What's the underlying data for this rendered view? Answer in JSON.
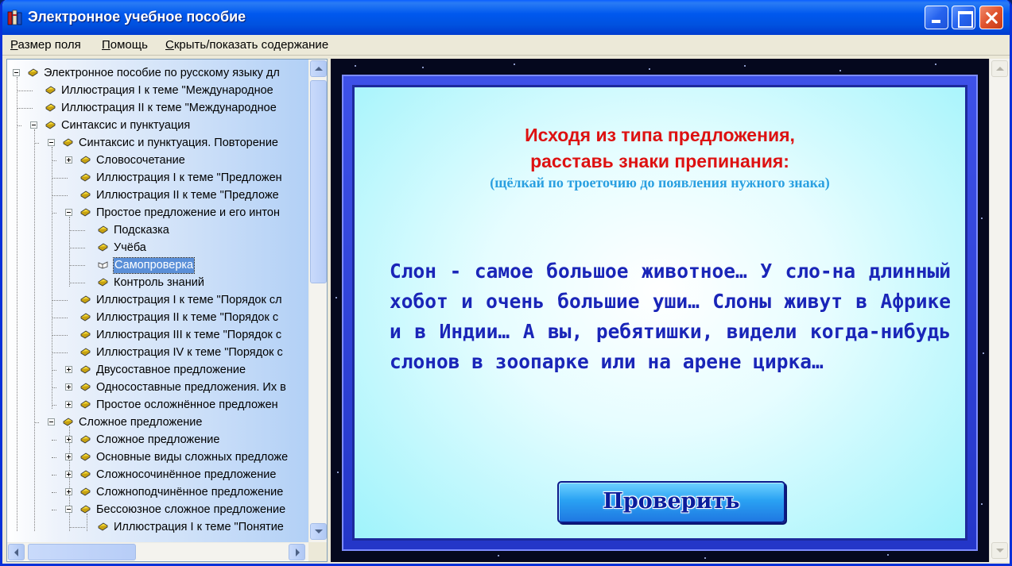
{
  "window": {
    "title": "Электронное учебное пособие"
  },
  "menu": {
    "items": [
      {
        "accel": "Р",
        "rest": "азмер поля"
      },
      {
        "accel": "П",
        "rest": "омощь"
      },
      {
        "accel": "С",
        "rest": "крыть/показать содержание"
      }
    ]
  },
  "tree": {
    "items": [
      {
        "label": "Электронное пособие по русскому языку дл",
        "level": 0,
        "expander": "minus"
      },
      {
        "label": "Иллюстрация I к теме \"Международное",
        "level": 1,
        "expander": "none"
      },
      {
        "label": "Иллюстрация II к теме \"Международное",
        "level": 1,
        "expander": "none"
      },
      {
        "label": "Синтаксис и пунктуация",
        "level": 1,
        "expander": "minus"
      },
      {
        "label": "Синтаксис и пунктуация. Повторение",
        "level": 2,
        "expander": "minus"
      },
      {
        "label": "Словосочетание",
        "level": 3,
        "expander": "plus"
      },
      {
        "label": "Иллюстрация I к теме \"Предложен",
        "level": 3,
        "expander": "none"
      },
      {
        "label": "Иллюстрация II к теме \"Предложе",
        "level": 3,
        "expander": "none"
      },
      {
        "label": "Простое предложение и его интон",
        "level": 3,
        "expander": "minus"
      },
      {
        "label": "Подсказка",
        "level": 4,
        "expander": "none"
      },
      {
        "label": "Учёба",
        "level": 4,
        "expander": "none"
      },
      {
        "label": "Самопроверка",
        "level": 4,
        "expander": "none",
        "selected": true
      },
      {
        "label": "Контроль знаний",
        "level": 4,
        "expander": "none"
      },
      {
        "label": "Иллюстрация I к теме \"Порядок сл",
        "level": 3,
        "expander": "none"
      },
      {
        "label": "Иллюстрация II к теме \"Порядок с",
        "level": 3,
        "expander": "none"
      },
      {
        "label": "Иллюстрация III к теме \"Порядок с",
        "level": 3,
        "expander": "none"
      },
      {
        "label": "Иллюстрация IV к теме \"Порядок с",
        "level": 3,
        "expander": "none"
      },
      {
        "label": "Двусоставное предложение",
        "level": 3,
        "expander": "plus"
      },
      {
        "label": "Односоставные предложения. Их в",
        "level": 3,
        "expander": "plus"
      },
      {
        "label": "Простое осложнённое предложен",
        "level": 3,
        "expander": "plus"
      },
      {
        "label": "Сложное предложение",
        "level": 2,
        "expander": "minus"
      },
      {
        "label": "Сложное предложение",
        "level": 3,
        "expander": "plus"
      },
      {
        "label": "Основные виды сложных предложе",
        "level": 3,
        "expander": "plus"
      },
      {
        "label": "Сложносочинённое предложение",
        "level": 3,
        "expander": "plus"
      },
      {
        "label": "Сложноподчинённое предложение",
        "level": 3,
        "expander": "plus"
      },
      {
        "label": "Бессоюзное сложное предложение",
        "level": 3,
        "expander": "minus"
      },
      {
        "label": "Иллюстрация I к теме \"Понятие",
        "level": 4,
        "expander": "none"
      }
    ]
  },
  "lesson": {
    "heading_line1": "Исходя из типа предложения,",
    "heading_line2": "расставь знаки препинания:",
    "hint": "(щёлкай по троеточию до появления нужного знака)",
    "exercise": "Слон - самое большое животное… У сло-на длинный хобот и очень большие уши… Слоны живут в Африке и в Индии… А вы, ребятишки, видели когда-нибудь слонов в зоопарке или на арене цирка…",
    "check_button": "Проверить"
  },
  "colors": {
    "title_bar": "#0058ee",
    "heading": "#dd1111",
    "hint": "#2a9fe0",
    "exercise_text": "#1a25b8",
    "selection": "#5a8fd8"
  }
}
